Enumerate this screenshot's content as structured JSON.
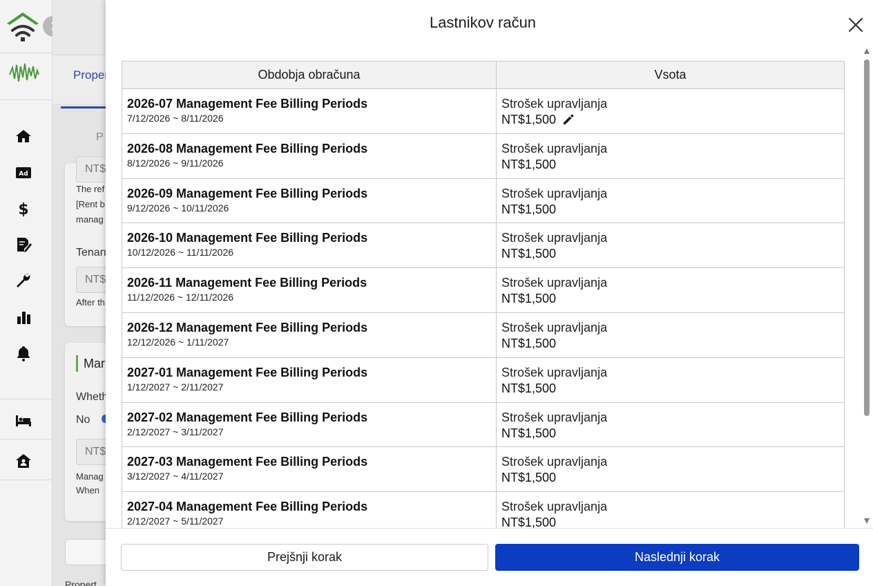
{
  "background": {
    "tab_label": "Proper",
    "subtab_label": "P",
    "input_prefix": "NT$",
    "note_lines": [
      "The ref",
      "[Rent b",
      "manag"
    ],
    "tenant_label": "Tenan",
    "after_text": "After th",
    "card_title": "Mar",
    "whether_label": "Wheth",
    "radio_no": "No",
    "mgmt_note_lines": [
      "Manag",
      "When "
    ],
    "footer_text": "Propert"
  },
  "sidebar": {
    "icons": [
      "wifi-home-logo",
      "brand-mark",
      "home-icon",
      "ad-icon",
      "dollar-icon",
      "contract-icon",
      "wrench-icon",
      "chart-icon",
      "bell-icon",
      "bed-icon",
      "house-user-icon"
    ],
    "ad_label": "Ad"
  },
  "modal": {
    "title": "Lastnikov račun",
    "columns": [
      "Obdobja obračuna",
      "Vsota"
    ],
    "rows": [
      {
        "title": "2026-07 Management Fee Billing Periods",
        "range": "7/12/2026 ~ 8/11/2026",
        "fee_label": "Strošek upravljanja",
        "amount": "NT$1,500"
      },
      {
        "title": "2026-08 Management Fee Billing Periods",
        "range": "8/12/2026 ~ 9/11/2026",
        "fee_label": "Strošek upravljanja",
        "amount": "NT$1,500"
      },
      {
        "title": "2026-09 Management Fee Billing Periods",
        "range": "9/12/2026 ~ 10/11/2026",
        "fee_label": "Strošek upravljanja",
        "amount": "NT$1,500"
      },
      {
        "title": "2026-10 Management Fee Billing Periods",
        "range": "10/12/2026 ~ 11/11/2026",
        "fee_label": "Strošek upravljanja",
        "amount": "NT$1,500"
      },
      {
        "title": "2026-11 Management Fee Billing Periods",
        "range": "11/12/2026 ~ 12/11/2026",
        "fee_label": "Strošek upravljanja",
        "amount": "NT$1,500"
      },
      {
        "title": "2026-12 Management Fee Billing Periods",
        "range": "12/12/2026 ~ 1/11/2027",
        "fee_label": "Strošek upravljanja",
        "amount": "NT$1,500"
      },
      {
        "title": "2027-01 Management Fee Billing Periods",
        "range": "1/12/2027 ~ 2/11/2027",
        "fee_label": "Strošek upravljanja",
        "amount": "NT$1,500"
      },
      {
        "title": "2027-02 Management Fee Billing Periods",
        "range": "2/12/2027 ~ 3/11/2027",
        "fee_label": "Strošek upravljanja",
        "amount": "NT$1,500"
      },
      {
        "title": "2027-03 Management Fee Billing Periods",
        "range": "3/12/2027 ~ 4/11/2027",
        "fee_label": "Strošek upravljanja",
        "amount": "NT$1,500"
      },
      {
        "title": "2027-04 Management Fee Billing Periods",
        "range": "2/12/2027 ~ 5/11/2027",
        "fee_label": "Strošek upravljanja",
        "amount": "NT$1,500"
      }
    ],
    "prev_button": "Prejšnji korak",
    "next_button": "Naslednji korak"
  },
  "colors": {
    "primary": "#0b3cc1",
    "tab_accent": "#2b4aa8",
    "logo_green": "#4a9a3a"
  }
}
